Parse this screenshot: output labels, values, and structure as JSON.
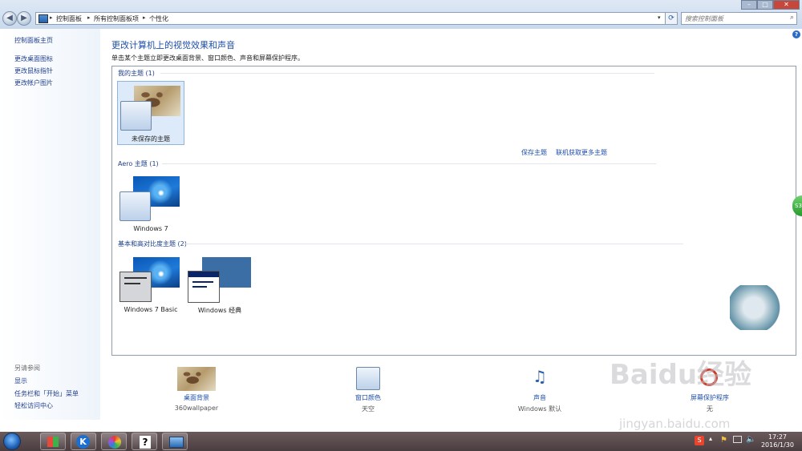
{
  "address": {
    "crumbs": [
      "控制面板",
      "所有控制面板项",
      "个性化"
    ]
  },
  "search": {
    "placeholder": "搜索控制面板"
  },
  "sidebar": {
    "home": "控制面板主页",
    "links": [
      "更改桌面图标",
      "更改鼠标指针",
      "更改帐户图片"
    ],
    "see_also_header": "另请参阅",
    "see_also": [
      "显示",
      "任务栏和「开始」菜单",
      "轻松访问中心"
    ]
  },
  "main": {
    "title": "更改计算机上的视觉效果和声音",
    "subtitle": "单击某个主题立即更改桌面背景、窗口颜色、声音和屏幕保护程序。",
    "groups": {
      "my": {
        "label": "我的主题 (1)",
        "themes": [
          "未保存的主题"
        ]
      },
      "aero": {
        "label": "Aero 主题 (1)",
        "themes": [
          "Windows 7"
        ]
      },
      "basic": {
        "label": "基本和高对比度主题 (2)",
        "themes": [
          "Windows 7 Basic",
          "Windows 经典"
        ]
      }
    },
    "save_theme": "保存主题",
    "get_more": "联机获取更多主题"
  },
  "bottom": {
    "background": {
      "name": "桌面背景",
      "value": "360wallpaper"
    },
    "color": {
      "name": "窗口颜色",
      "value": "天空"
    },
    "sound": {
      "name": "声音",
      "value": "Windows 默认"
    },
    "screensaver": {
      "name": "屏幕保护程序",
      "value": "无"
    }
  },
  "taskbar": {
    "time": "17:27",
    "date": "2016/1/30"
  },
  "watermark": {
    "main": "Baidu经验",
    "sub": "jingyan.baidu.com"
  },
  "colors": {
    "link": "#1f4fa8",
    "accent_selected": "#dceaf9"
  }
}
